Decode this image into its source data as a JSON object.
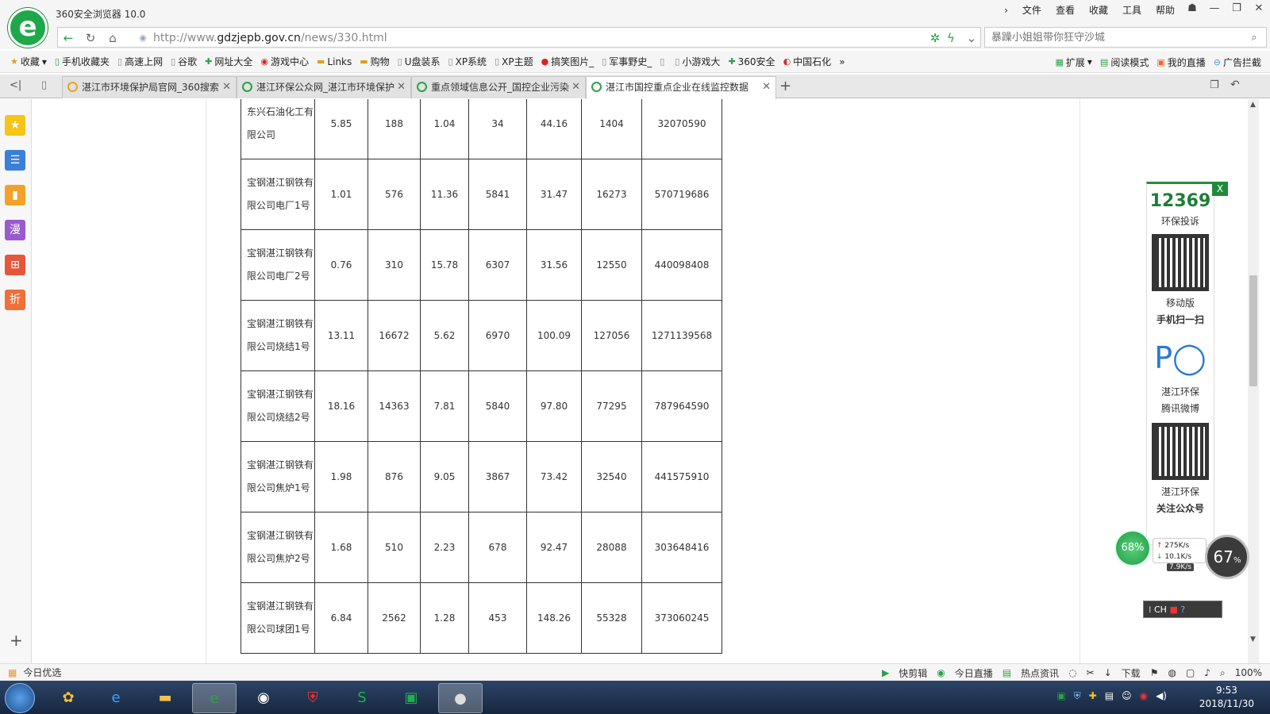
{
  "window": {
    "app_title": "360安全浏览器 10.0",
    "menu": [
      "文件",
      "查看",
      "收藏",
      "工具",
      "帮助"
    ],
    "controls": [
      "☗",
      "—",
      "❐",
      "✕"
    ]
  },
  "address": {
    "url_prefix": "http://www.",
    "url_domain": "gdzjepb.gov.cn",
    "url_path": "/news/330.html",
    "search_placeholder": "暴躁小姐姐带你狂守沙城"
  },
  "bookmarks": {
    "items": [
      "收藏",
      "手机收藏夹",
      "高速上网",
      "谷歌",
      "网址大全",
      "游戏中心",
      "Links",
      "购物",
      "U盘装系",
      "XP系统",
      "XP主题",
      "搞笑图片_",
      "军事野史_",
      "",
      "小游戏大",
      "360安全",
      "中国石化"
    ],
    "more": "»",
    "right_items": [
      "扩展",
      "阅读模式",
      "我的直播",
      "广告拦截"
    ]
  },
  "tabs": [
    {
      "label": "湛江市环境保护局官网_360搜索"
    },
    {
      "label": "湛江环保公众网_湛江市环境保护"
    },
    {
      "label": "重点领域信息公开_国控企业污染"
    },
    {
      "label": "湛江市国控重点企业在线监控数据"
    }
  ],
  "table": {
    "rows": [
      {
        "name": "东兴石油化工有限公司",
        "values": [
          "5.85",
          "188",
          "1.04",
          "34",
          "44.16",
          "1404",
          "32070590"
        ]
      },
      {
        "name": "宝钢湛江钢铁有限公司电厂1号",
        "values": [
          "1.01",
          "576",
          "11.36",
          "5841",
          "31.47",
          "16273",
          "570719686"
        ]
      },
      {
        "name": "宝钢湛江钢铁有限公司电厂2号",
        "values": [
          "0.76",
          "310",
          "15.78",
          "6307",
          "31.56",
          "12550",
          "440098408"
        ]
      },
      {
        "name": "宝钢湛江钢铁有限公司烧结1号",
        "values": [
          "13.11",
          "16672",
          "5.62",
          "6970",
          "100.09",
          "127056",
          "1271139568"
        ]
      },
      {
        "name": "宝钢湛江钢铁有限公司烧结2号",
        "values": [
          "18.16",
          "14363",
          "7.81",
          "5840",
          "97.80",
          "77295",
          "787964590"
        ]
      },
      {
        "name": "宝钢湛江钢铁有限公司焦炉1号",
        "values": [
          "1.98",
          "876",
          "9.05",
          "3867",
          "73.42",
          "32540",
          "441575910"
        ]
      },
      {
        "name": "宝钢湛江钢铁有限公司焦炉2号",
        "values": [
          "1.68",
          "510",
          "2.23",
          "678",
          "92.47",
          "28088",
          "303648416"
        ]
      },
      {
        "name": "宝钢湛江钢铁有限公司球团1号",
        "values": [
          "6.84",
          "2562",
          "1.28",
          "453",
          "148.26",
          "55328",
          "373060245"
        ]
      }
    ]
  },
  "widget": {
    "close": "X",
    "hotline": "12369",
    "hotline_label": "环保投诉",
    "mobile_label": "移动版",
    "scan_label": "手机扫一扫",
    "weibo_label": "湛江环保",
    "weibo_sub": "腾讯微博",
    "wechat_label": "湛江环保",
    "wechat_sub": "关注公众号"
  },
  "meters": {
    "cpu": "68%",
    "up": "275K/s",
    "down": "10.1K/s",
    "extra": "7.9K/s",
    "mem": "67",
    "mem_unit": "%",
    "ime": "CH"
  },
  "status": {
    "left": "今日优选",
    "right": [
      "快剪辑",
      "今日直播",
      "热点资讯",
      "下载",
      "100%"
    ]
  },
  "taskbar": {
    "time": "9:53",
    "date": "2018/11/30"
  }
}
